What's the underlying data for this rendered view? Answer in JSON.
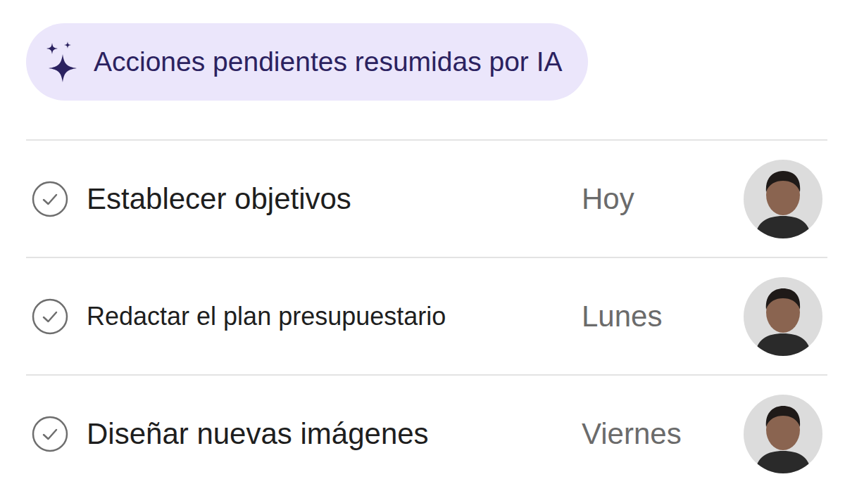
{
  "header": {
    "title": "Acciones pendientes resumidas por IA"
  },
  "tasks": [
    {
      "text": "Establecer objetivos",
      "due": "Hoy"
    },
    {
      "text": "Redactar el plan presupuestario",
      "due": "Lunes"
    },
    {
      "text": "Diseñar nuevas imágenes",
      "due": "Viernes"
    }
  ]
}
